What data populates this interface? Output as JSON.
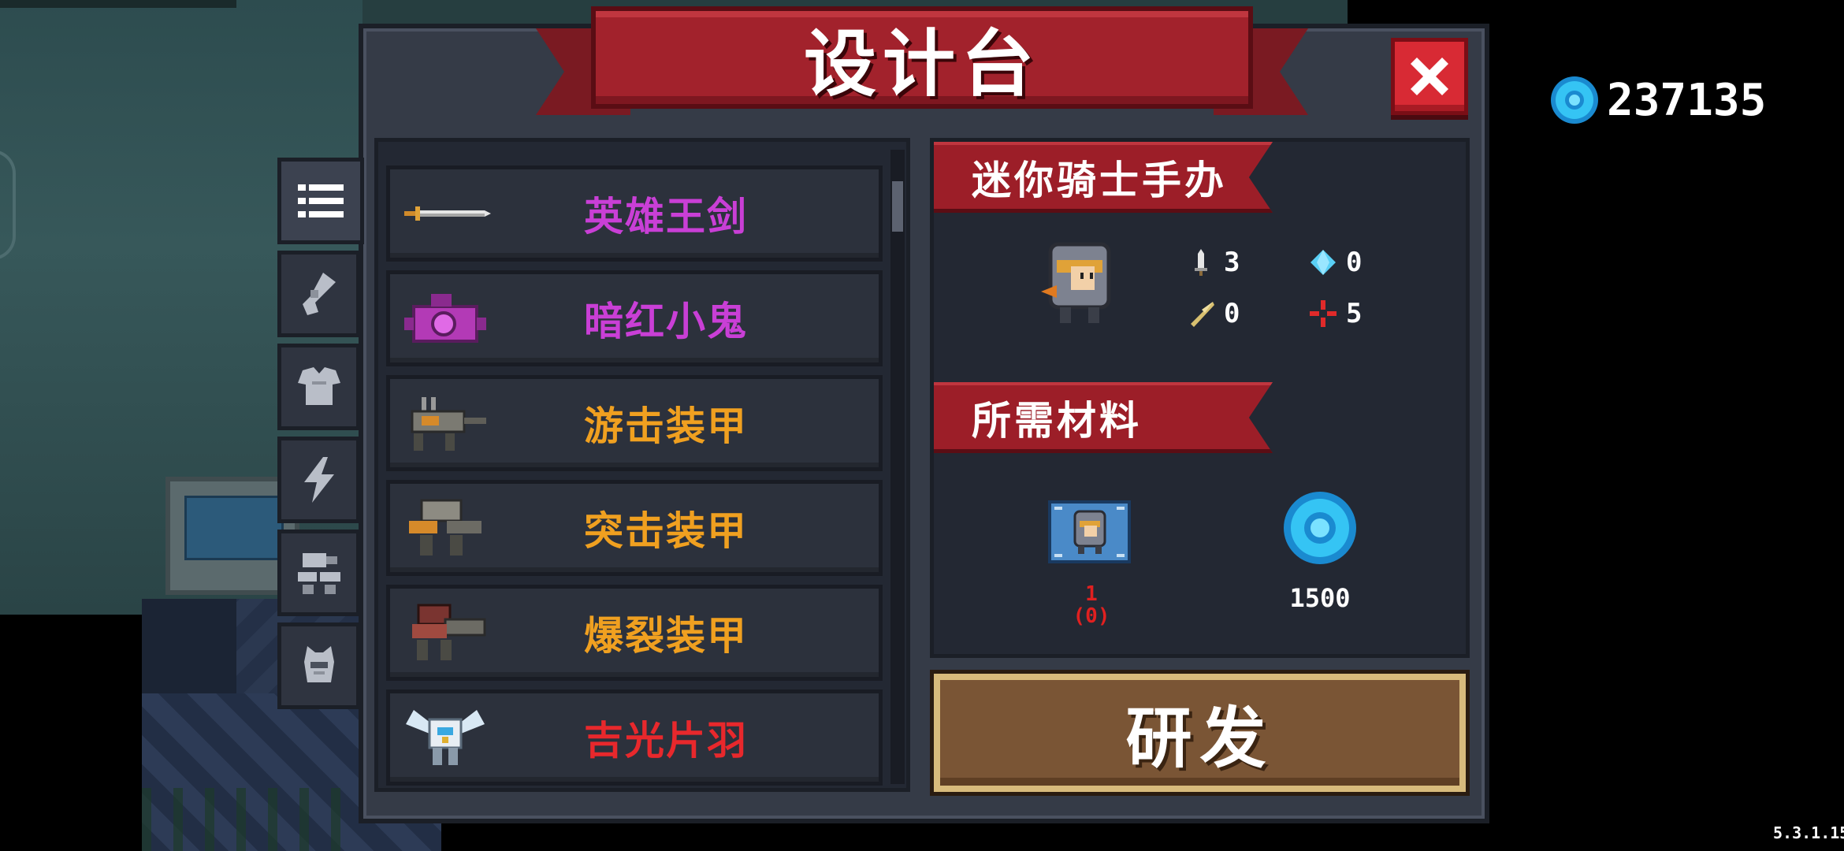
{
  "title": "设计台",
  "currency": {
    "value": "237135",
    "icon": "blue-gem-icon"
  },
  "version": "5.3.1.15",
  "tabs": [
    {
      "name": "tab-list",
      "icon": "list-icon",
      "active": true
    },
    {
      "name": "tab-weapons",
      "icon": "gun-icon",
      "active": false
    },
    {
      "name": "tab-armor",
      "icon": "armor-icon",
      "active": false
    },
    {
      "name": "tab-skills",
      "icon": "lightning-icon",
      "active": false
    },
    {
      "name": "tab-mechs",
      "icon": "mech-icon",
      "active": false
    },
    {
      "name": "tab-pets",
      "icon": "pet-icon",
      "active": false
    }
  ],
  "items": [
    {
      "label": "英雄王剑",
      "color": "#c93fd6",
      "icon": "sword-icon"
    },
    {
      "label": "暗红小鬼",
      "color": "#c93fd6",
      "icon": "camera-robot-icon"
    },
    {
      "label": "游击装甲",
      "color": "#f0a020",
      "icon": "guerrilla-mech-icon"
    },
    {
      "label": "突击装甲",
      "color": "#f0a020",
      "icon": "assault-mech-icon"
    },
    {
      "label": "爆裂装甲",
      "color": "#f0a020",
      "icon": "burst-mech-icon"
    },
    {
      "label": "吉光片羽",
      "color": "#e8282c",
      "icon": "winged-mech-icon"
    }
  ],
  "detail": {
    "item_name": "迷你骑士手办",
    "stats": [
      {
        "icon": "dagger-icon",
        "value": "3"
      },
      {
        "icon": "diamond-icon",
        "value": "0"
      },
      {
        "icon": "needle-icon",
        "value": "0"
      },
      {
        "icon": "crosshair-icon",
        "value": "5"
      }
    ],
    "materials_label": "所需材料",
    "materials": [
      {
        "icon": "blueprint-icon",
        "qty": "1",
        "owned": "(0)"
      },
      {
        "icon": "blue-gem-icon",
        "qty": "1500"
      }
    ]
  },
  "develop_label": "研发",
  "colors": {
    "banner_red": "#a2222c",
    "panel": "#353b47",
    "develop_brown": "#7a5535",
    "gem_blue": "#35c4f4"
  }
}
